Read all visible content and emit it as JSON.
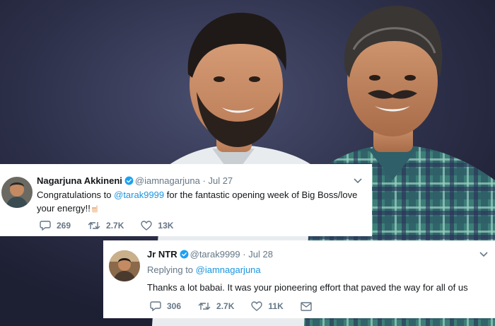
{
  "tweets": [
    {
      "name": "Nagarjuna Akkineni",
      "handle": "@iamnagarjuna",
      "separator": "·",
      "date": "Jul 27",
      "text_before": "Congratulations to ",
      "mention": "@tarak9999",
      "text_after": " for the fantastic opening week of Big Boss/love your energy!!",
      "emoji": "point-left-hand-emoji",
      "replies": "269",
      "retweets": "2.7K",
      "likes": "13K"
    },
    {
      "name": "Jr NTR",
      "handle": "@tarak9999",
      "separator": "·",
      "date": "Jul 28",
      "replying_label": "Replying to ",
      "replying_to": "@iamnagarjuna",
      "text": "Thanks a lot babai. It was your pioneering effort that paved the way for all of us",
      "replies": "306",
      "retweets": "2.7K",
      "likes": "11K"
    }
  ],
  "colors": {
    "link": "#1b95e0",
    "muted": "#657786",
    "text": "#14171a",
    "verified": "#1da1f2",
    "card": "#ffffff",
    "background": "#2a2d45"
  },
  "icons": {
    "verified": "verified-badge-icon",
    "chevron": "chevron-down-icon",
    "reply": "reply-icon",
    "retweet": "retweet-icon",
    "like": "heart-icon",
    "dm": "envelope-icon"
  }
}
